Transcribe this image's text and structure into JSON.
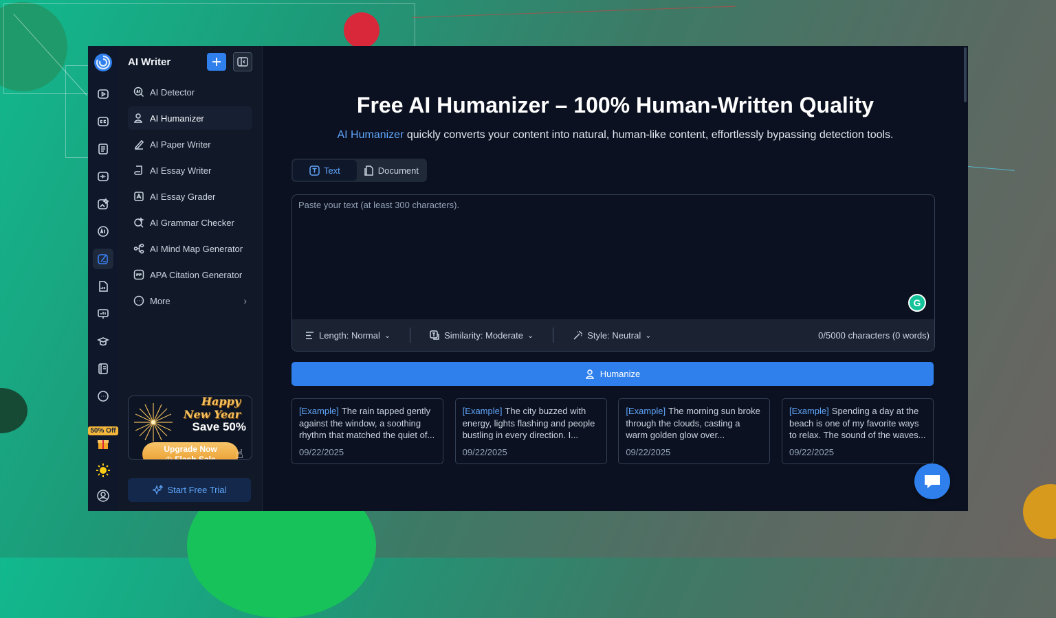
{
  "sidebar": {
    "title": "AI Writer",
    "items": [
      {
        "label": "AI Detector",
        "icon": "ai-search-icon"
      },
      {
        "label": "AI Humanizer",
        "icon": "person-icon"
      },
      {
        "label": "AI Paper Writer",
        "icon": "pen-icon"
      },
      {
        "label": "AI Essay Writer",
        "icon": "scroll-icon"
      },
      {
        "label": "AI Essay Grader",
        "icon": "grade-icon"
      },
      {
        "label": "AI Grammar Checker",
        "icon": "magnifier-check-icon"
      },
      {
        "label": "AI Mind Map Generator",
        "icon": "mindmap-icon"
      },
      {
        "label": "APA Citation Generator",
        "icon": "quote-icon"
      },
      {
        "label": "More",
        "icon": "more-icon"
      }
    ],
    "promo": {
      "headline": "Happy New Year",
      "offer": "Save 50%",
      "button_line1": "Upgrade Now",
      "button_line2": "Flash Sale"
    },
    "trial_button": "Start Free Trial"
  },
  "rail": {
    "discount_badge": "50% Off",
    "icons": [
      "video-icon",
      "captions-icon",
      "document-icon",
      "audio-wave-icon",
      "image-edit-icon",
      "ai-chip-icon",
      "writer-icon",
      "pdf-icon",
      "presentation-icon",
      "graduation-icon",
      "notebook-icon",
      "more-circle-icon"
    ]
  },
  "main": {
    "headline": "Free AI Humanizer – 100% Human-Written Quality",
    "subline_highlight": "AI Humanizer",
    "subline_rest": " quickly converts your content into natural, human-like content, effortlessly bypassing detection tools.",
    "tabs": [
      {
        "label": "Text"
      },
      {
        "label": "Document"
      }
    ],
    "editor": {
      "placeholder": "Paste your text (at least 300 characters).",
      "value": ""
    },
    "options": {
      "length": "Length: Normal",
      "similarity": "Similarity: Moderate",
      "style": "Style: Neutral",
      "count": "0/5000 characters (0 words)"
    },
    "humanize_button": "Humanize",
    "examples": [
      {
        "tag": "[Example]",
        "text": "The rain tapped gently against the window, a soothing rhythm that matched the quiet of...",
        "date": "09/22/2025"
      },
      {
        "tag": "[Example]",
        "text": "The city buzzed with energy, lights flashing and people bustling in every direction. I...",
        "date": "09/22/2025"
      },
      {
        "tag": "[Example]",
        "text": "The morning sun broke through the clouds, casting a warm golden glow over...",
        "date": "09/22/2025"
      },
      {
        "tag": "[Example]",
        "text": "Spending a day at the beach is one of my favorite ways to relax. The sound of the waves...",
        "date": "09/22/2025"
      }
    ]
  },
  "colors": {
    "accent": "#2f80ed",
    "link": "#60a5fa",
    "background": "#0b1120",
    "sidebar": "#111827"
  }
}
